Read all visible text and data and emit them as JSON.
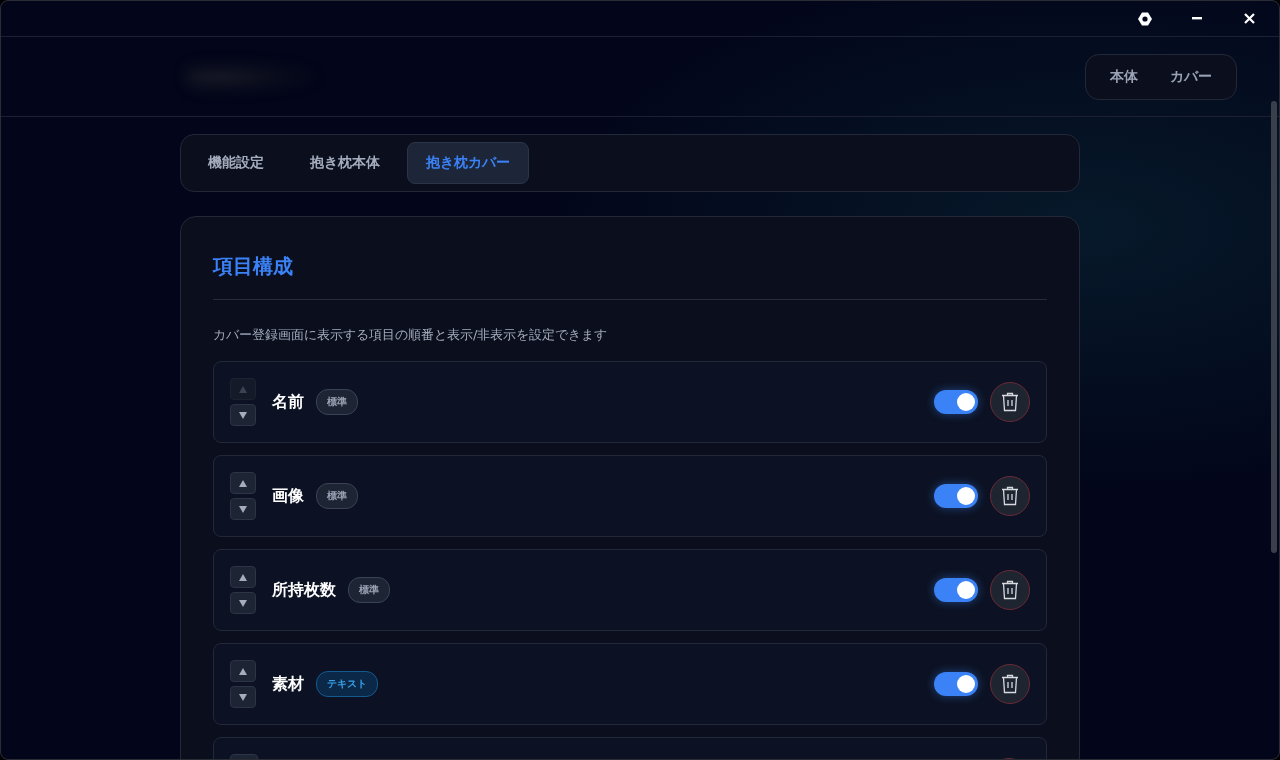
{
  "header": {
    "switch": [
      {
        "label": "本体",
        "selected": false
      },
      {
        "label": "カバー",
        "selected": false
      }
    ]
  },
  "tabs": [
    {
      "label": "機能設定",
      "selected": false
    },
    {
      "label": "抱き枕本体",
      "selected": false
    },
    {
      "label": "抱き枕カバー",
      "selected": true
    }
  ],
  "section": {
    "title": "項目構成",
    "description": "カバー登録画面に表示する項目の順番と表示/非表示を設定できます",
    "items": [
      {
        "kind": "row",
        "name": "名前",
        "tag": {
          "label": "標準",
          "kind": "standard"
        },
        "up_disabled": true,
        "down_disabled": false,
        "on": true
      },
      {
        "kind": "row",
        "name": "画像",
        "tag": {
          "label": "標準",
          "kind": "standard"
        },
        "up_disabled": false,
        "down_disabled": false,
        "on": true
      },
      {
        "kind": "row",
        "name": "所持枚数",
        "tag": {
          "label": "標準",
          "kind": "standard"
        },
        "up_disabled": false,
        "down_disabled": false,
        "on": true
      },
      {
        "kind": "row",
        "name": "素材",
        "tag": {
          "label": "テキスト",
          "kind": "text"
        },
        "up_disabled": false,
        "down_disabled": false,
        "on": true
      },
      {
        "kind": "cut"
      }
    ]
  }
}
